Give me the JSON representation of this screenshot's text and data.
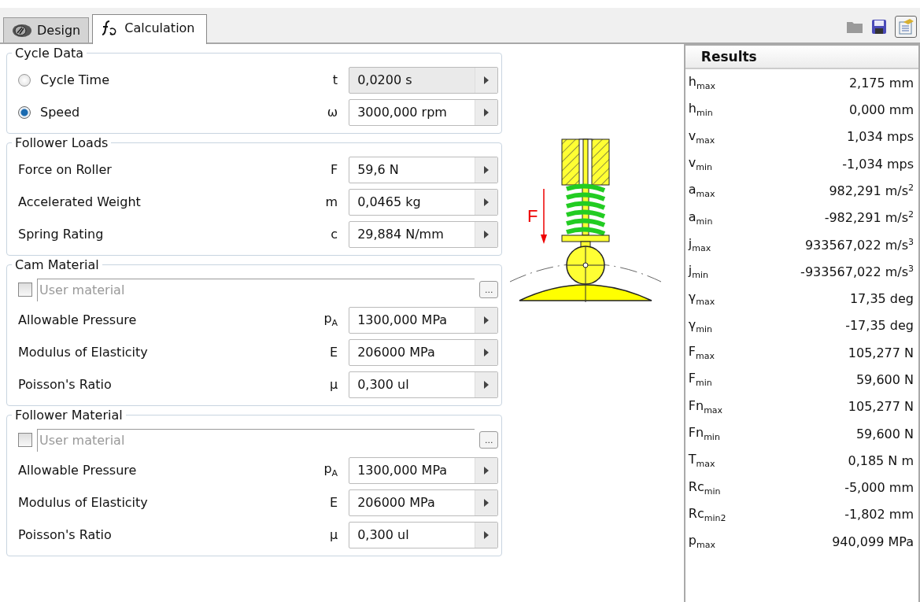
{
  "tabs": [
    {
      "label": "Design",
      "selected": false,
      "kind": "design"
    },
    {
      "label": "Calculation",
      "selected": true,
      "kind": "calc"
    }
  ],
  "groups": [
    {
      "title": "Cycle Data",
      "rows": [
        {
          "kind": "radio",
          "label": "Cycle Time",
          "selected": false,
          "symbol": "t",
          "value": "0,0200 s",
          "disabled": true
        },
        {
          "kind": "radio",
          "label": "Speed",
          "selected": true,
          "symbol": "ω",
          "value": "3000,000 rpm",
          "disabled": false
        }
      ]
    },
    {
      "title": "Follower Loads",
      "rows": [
        {
          "kind": "input",
          "label": "Force on Roller",
          "symbol": "F",
          "value": "59,6 N",
          "disabled": false
        },
        {
          "kind": "input",
          "label": "Accelerated Weight",
          "symbol": "m",
          "value": "0,0465 kg",
          "disabled": false
        },
        {
          "kind": "input",
          "label": "Spring Rating",
          "symbol": "c",
          "value": "29,884 N/mm",
          "disabled": false
        }
      ]
    },
    {
      "title": "Cam Material",
      "rows": [
        {
          "kind": "material",
          "checked": false,
          "placeholder": "User material",
          "browse": "..."
        },
        {
          "kind": "input",
          "label": "Allowable Pressure",
          "symbol": "p$_{A}$",
          "value": "1300,000 MPa",
          "disabled": false
        },
        {
          "kind": "input",
          "label": "Modulus of Elasticity",
          "symbol": "E",
          "value": "206000 MPa",
          "disabled": false
        },
        {
          "kind": "input",
          "label": "Poisson's Ratio",
          "symbol": "µ",
          "value": "0,300 ul",
          "disabled": false
        }
      ]
    },
    {
      "title": "Follower Material",
      "rows": [
        {
          "kind": "material",
          "checked": false,
          "placeholder": "User material",
          "browse": "..."
        },
        {
          "kind": "input",
          "label": "Allowable Pressure",
          "symbol": "p$_{A}$",
          "value": "1300,000 MPa",
          "disabled": false
        },
        {
          "kind": "input",
          "label": "Modulus of Elasticity",
          "symbol": "E",
          "value": "206000 MPa",
          "disabled": false
        },
        {
          "kind": "input",
          "label": "Poisson's Ratio",
          "symbol": "µ",
          "value": "0,300 ul",
          "disabled": false
        }
      ]
    }
  ],
  "diagram": {
    "force_label": "F"
  },
  "results": {
    "title": "Results",
    "rows": [
      {
        "name": "h$_{max}$",
        "value": "2,175 mm"
      },
      {
        "name": "h$_{min}$",
        "value": "0,000 mm"
      },
      {
        "name": "v$_{max}$",
        "value": "1,034 mps"
      },
      {
        "name": "v$_{min}$",
        "value": "-1,034 mps"
      },
      {
        "name": "a$_{max}$",
        "value": "982,291 m/s$^{2}$"
      },
      {
        "name": "a$_{min}$",
        "value": "-982,291 m/s$^{2}$"
      },
      {
        "name": "j$_{max}$",
        "value": "933567,022 m/s$^{3}$"
      },
      {
        "name": "j$_{min}$",
        "value": "-933567,022 m/s$^{3}$"
      },
      {
        "name": "γ$_{max}$",
        "value": "17,35 deg"
      },
      {
        "name": "γ$_{min}$",
        "value": "-17,35 deg"
      },
      {
        "name": "F$_{max}$",
        "value": "105,277 N"
      },
      {
        "name": "F$_{min}$",
        "value": "59,600 N"
      },
      {
        "name": "Fn$_{max}$",
        "value": "105,277 N"
      },
      {
        "name": "Fn$_{min}$",
        "value": "59,600 N"
      },
      {
        "name": "T$_{max}$",
        "value": "0,185 N m"
      },
      {
        "name": "Rc$_{min}$",
        "value": "-5,000 mm"
      },
      {
        "name": "Rc$_{min2}$",
        "value": "-1,802 mm"
      },
      {
        "name": "p$_{max}$",
        "value": "940,099 MPa"
      }
    ]
  }
}
